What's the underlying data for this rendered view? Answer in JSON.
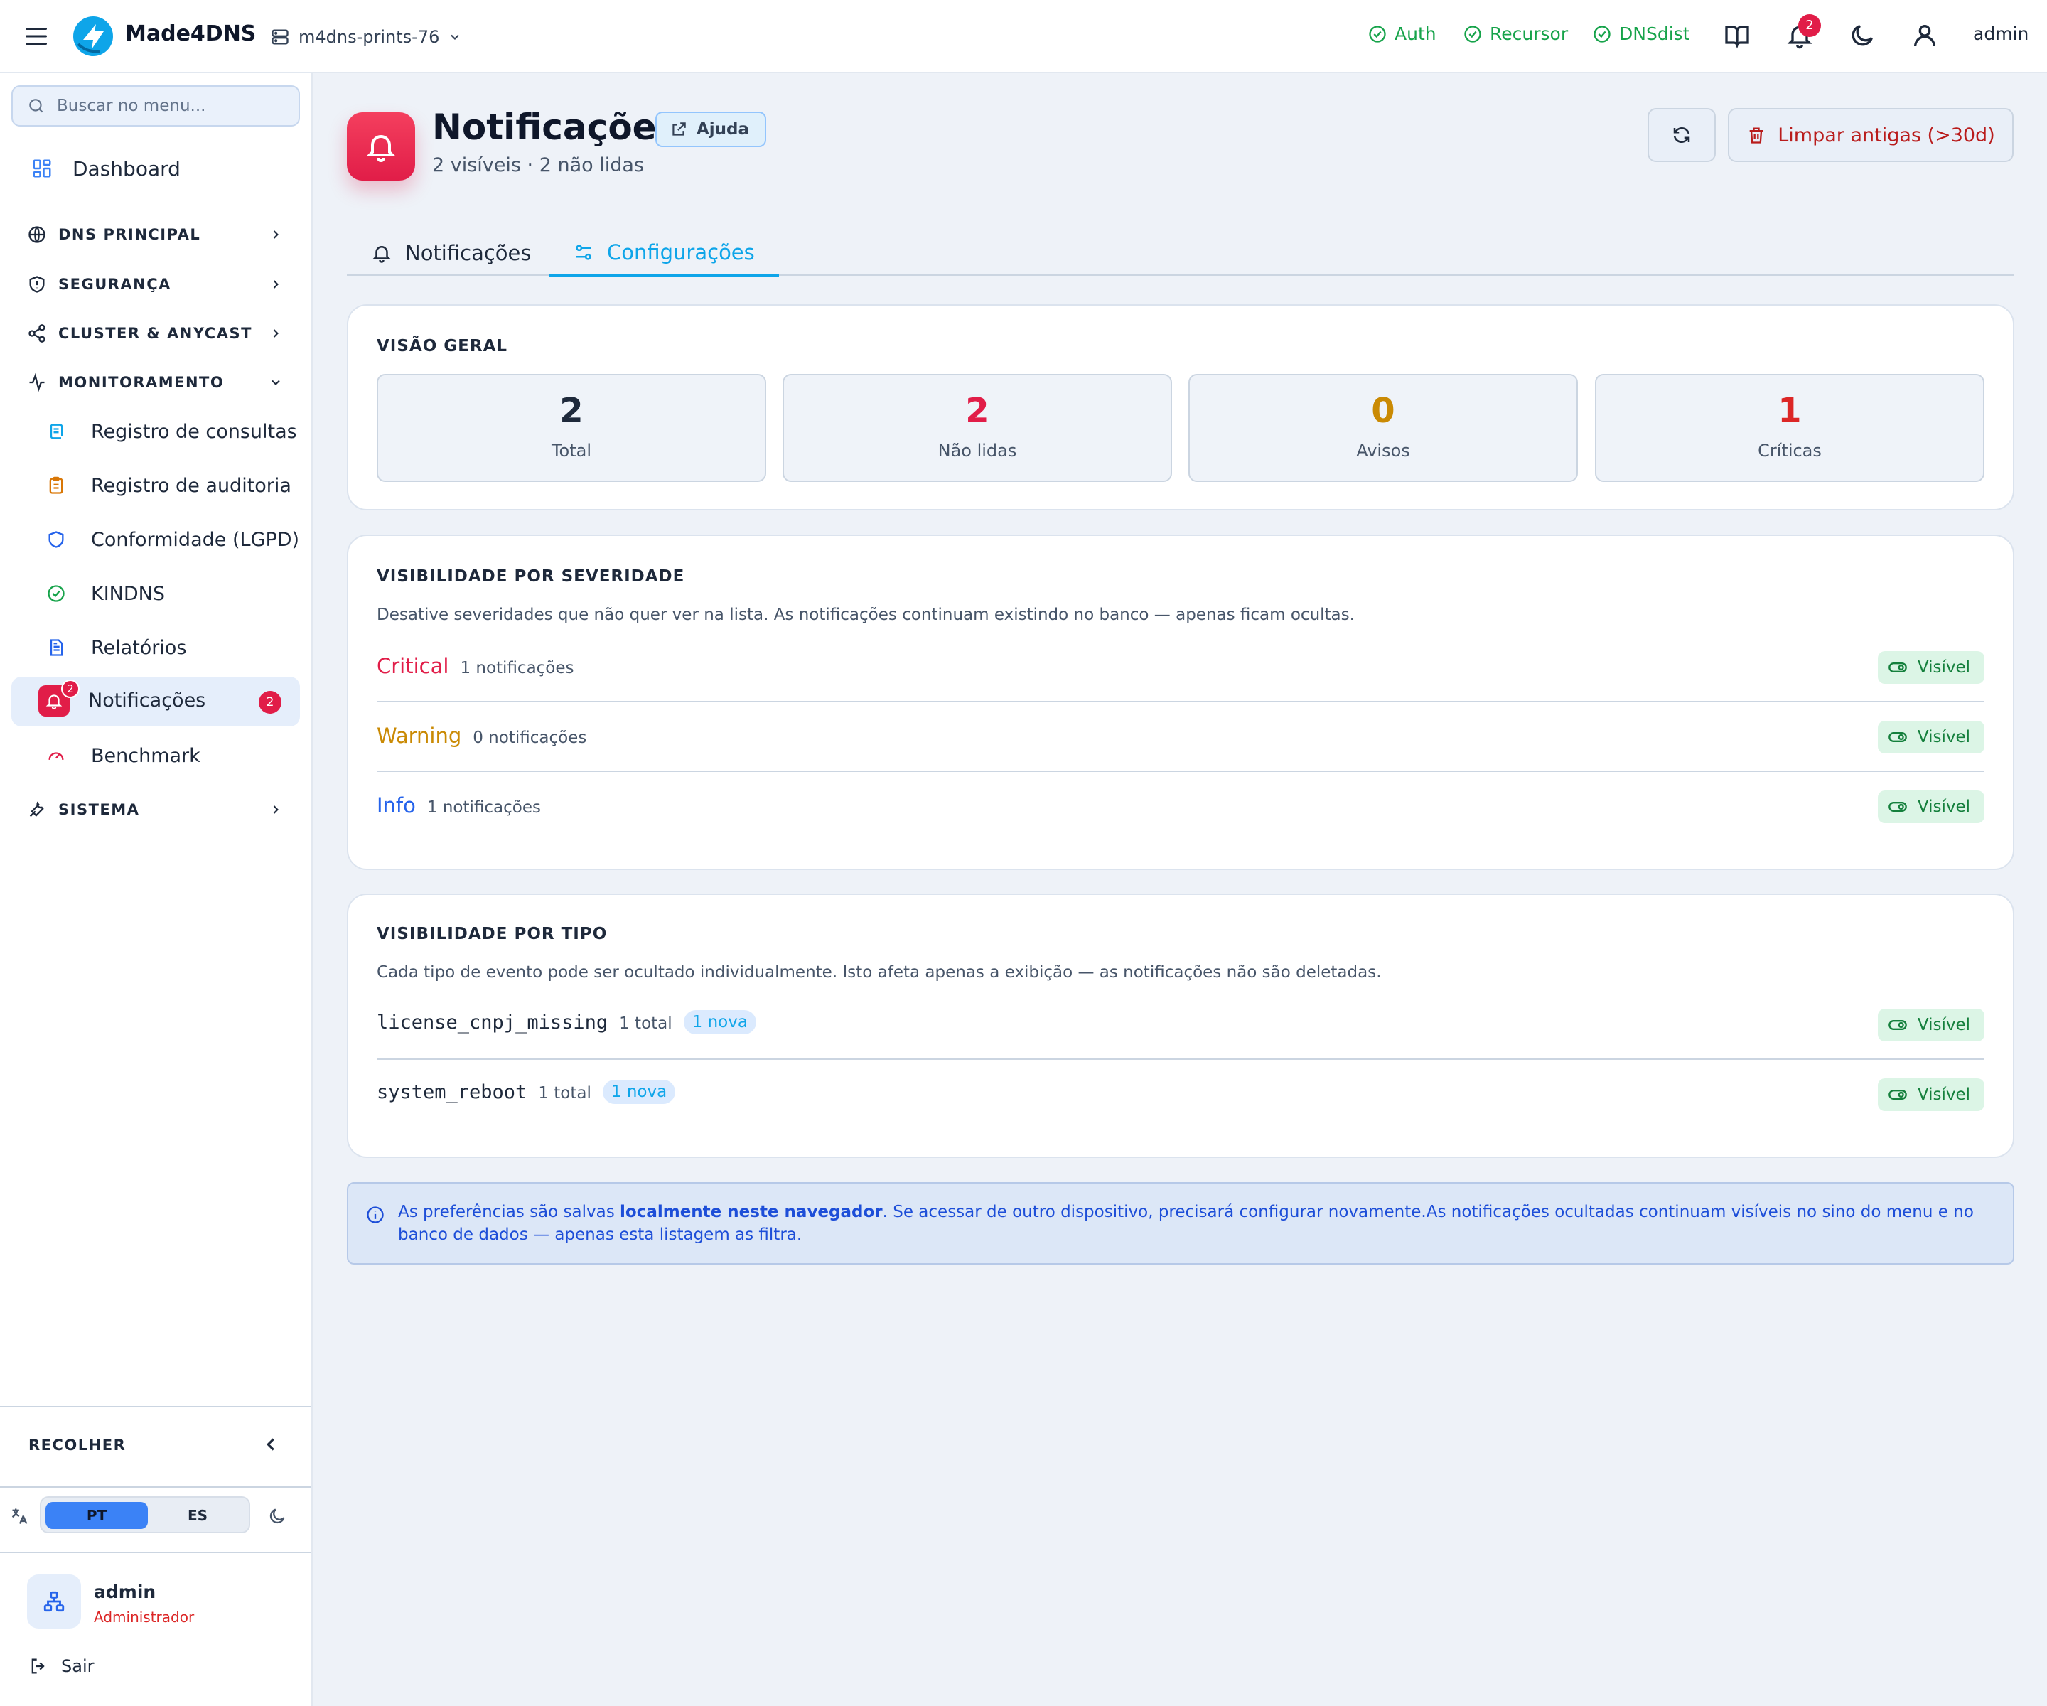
{
  "app": {
    "brand": "Made4DNS",
    "server": "m4dns-prints-76",
    "status": [
      {
        "label": "Auth",
        "color": "#16a34a"
      },
      {
        "label": "Recursor",
        "color": "#16a34a"
      },
      {
        "label": "DNSdist",
        "color": "#16a34a"
      }
    ],
    "notification_count": "2",
    "user": "admin"
  },
  "sidebar": {
    "search_placeholder": "Buscar no menu...",
    "dashboard": "Dashboard",
    "sections": {
      "dns": "DNS PRINCIPAL",
      "security": "SEGURANÇA",
      "cluster": "CLUSTER & ANYCAST",
      "monitor": "MONITORAMENTO",
      "system": "SISTEMA"
    },
    "monitor_items": [
      {
        "label": "Registro de consultas",
        "icon": "scroll-icon"
      },
      {
        "label": "Registro de auditoria",
        "icon": "clipboard-icon"
      },
      {
        "label": "Conformidade (LGPD)",
        "icon": "shield-icon"
      },
      {
        "label": "KINDNS",
        "icon": "check-circle-icon"
      },
      {
        "label": "Relatórios",
        "icon": "file-text-icon"
      },
      {
        "label": "Notificações",
        "icon": "bell-icon",
        "badge": "2",
        "active": true
      },
      {
        "label": "Benchmark",
        "icon": "gauge-icon"
      }
    ],
    "collapse_label": "RECOLHER",
    "lang": {
      "pt": "PT",
      "es": "ES"
    },
    "user": {
      "name": "admin",
      "role": "Administrador"
    },
    "logout": "Sair"
  },
  "page": {
    "title": "Notificações",
    "help": "Ajuda",
    "subtitle": "2 visíveis · 2 não lidas",
    "clear_button": "Limpar antigas (>30d)",
    "tabs": [
      {
        "label": "Notificações",
        "active": false
      },
      {
        "label": "Configurações",
        "active": true
      }
    ]
  },
  "overview": {
    "title": "VISÃO GERAL",
    "stats": [
      {
        "value": "2",
        "label": "Total",
        "color": "#1e293b"
      },
      {
        "value": "2",
        "label": "Não lidas",
        "color": "#e11d48"
      },
      {
        "value": "0",
        "label": "Avisos",
        "color": "#ca8a04"
      },
      {
        "value": "1",
        "label": "Críticas",
        "color": "#dc2626"
      }
    ]
  },
  "severity": {
    "title": "VISIBILIDADE POR SEVERIDADE",
    "description": "Desative severidades que não quer ver na lista. As notificações continuam existindo no banco — apenas ficam ocultas.",
    "rows": [
      {
        "name": "Critical",
        "count": "1 notificações",
        "status": "Visível",
        "color": "#e11d48"
      },
      {
        "name": "Warning",
        "count": "0 notificações",
        "status": "Visível",
        "color": "#ca8a04"
      },
      {
        "name": "Info",
        "count": "1 notificações",
        "status": "Visível",
        "color": "#2563eb"
      }
    ]
  },
  "types": {
    "title": "VISIBILIDADE POR TIPO",
    "description": "Cada tipo de evento pode ser ocultado individualmente. Isto afeta apenas a exibição — as notificações não são deletadas.",
    "rows": [
      {
        "name": "license_cnpj_missing",
        "total": "1 total",
        "new": "1 nova",
        "status": "Visível"
      },
      {
        "name": "system_reboot",
        "total": "1 total",
        "new": "1 nova",
        "status": "Visível"
      }
    ]
  },
  "info": {
    "prefix": "As preferências são salvas ",
    "bold": "localmente neste navegador",
    "suffix": ". Se acessar de outro dispositivo, precisará configurar novamente.As notificações ocultadas continuam visíveis no sino do menu e no banco de dados — apenas esta listagem as filtra."
  }
}
